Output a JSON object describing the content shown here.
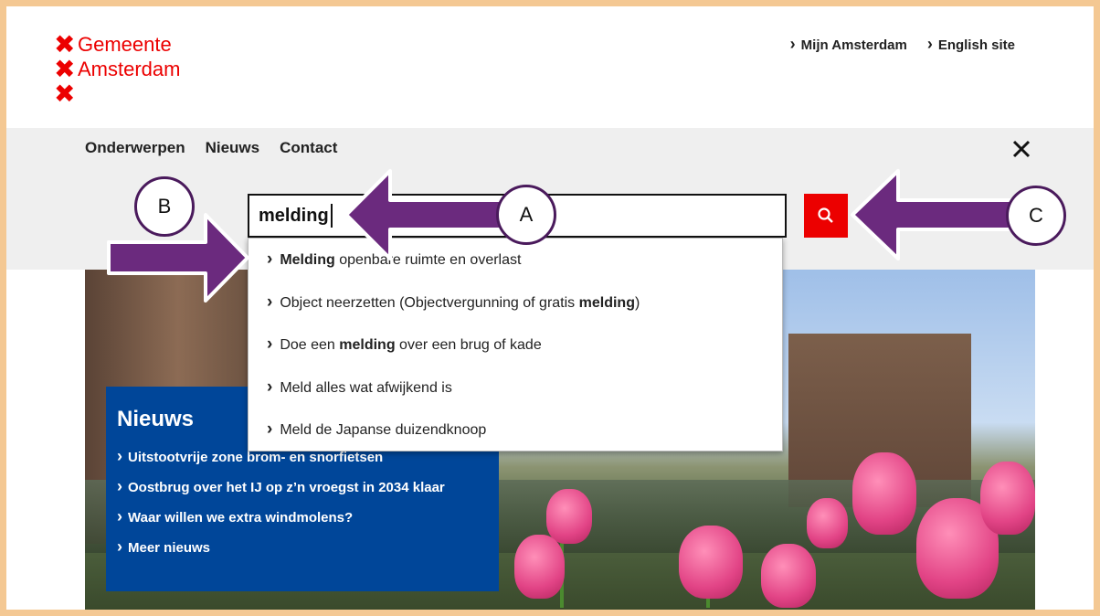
{
  "header": {
    "logo_line1": "Gemeente",
    "logo_line2": "Amsterdam",
    "logo_mark": "✖",
    "links": [
      "Mijn Amsterdam",
      "English site"
    ]
  },
  "nav": {
    "items": [
      "Onderwerpen",
      "Nieuws",
      "Contact"
    ],
    "close_icon": "close-icon"
  },
  "search": {
    "value": "melding",
    "button_icon": "search-icon"
  },
  "suggestions": [
    {
      "bold": "Melding",
      "rest": " openbare ruimte en overlast",
      "pre": ""
    },
    {
      "pre": "Object neerzetten (Objectvergunning of gratis ",
      "bold": "melding",
      "rest": ")"
    },
    {
      "pre": "Doe een ",
      "bold": "melding",
      "rest": " over een brug of kade"
    },
    {
      "pre": "Meld alles wat afwijkend is",
      "bold": "",
      "rest": ""
    },
    {
      "pre": "Meld de Japanse duizendknoop",
      "bold": "",
      "rest": ""
    }
  ],
  "news": {
    "title": "Nieuws",
    "items": [
      "Uitstootvrije zone brom- en snorfietsen",
      "Oostbrug over het IJ op z’n vroegst in 2034 klaar",
      "Waar willen we extra windmolens?",
      "Meer nieuws"
    ]
  },
  "annotations": {
    "a": "A",
    "b": "B",
    "c": "C"
  },
  "colors": {
    "brand_red": "#ec0000",
    "news_blue": "#004699",
    "annotation_purple": "#6b2a7e",
    "frame": "#f4c893"
  }
}
